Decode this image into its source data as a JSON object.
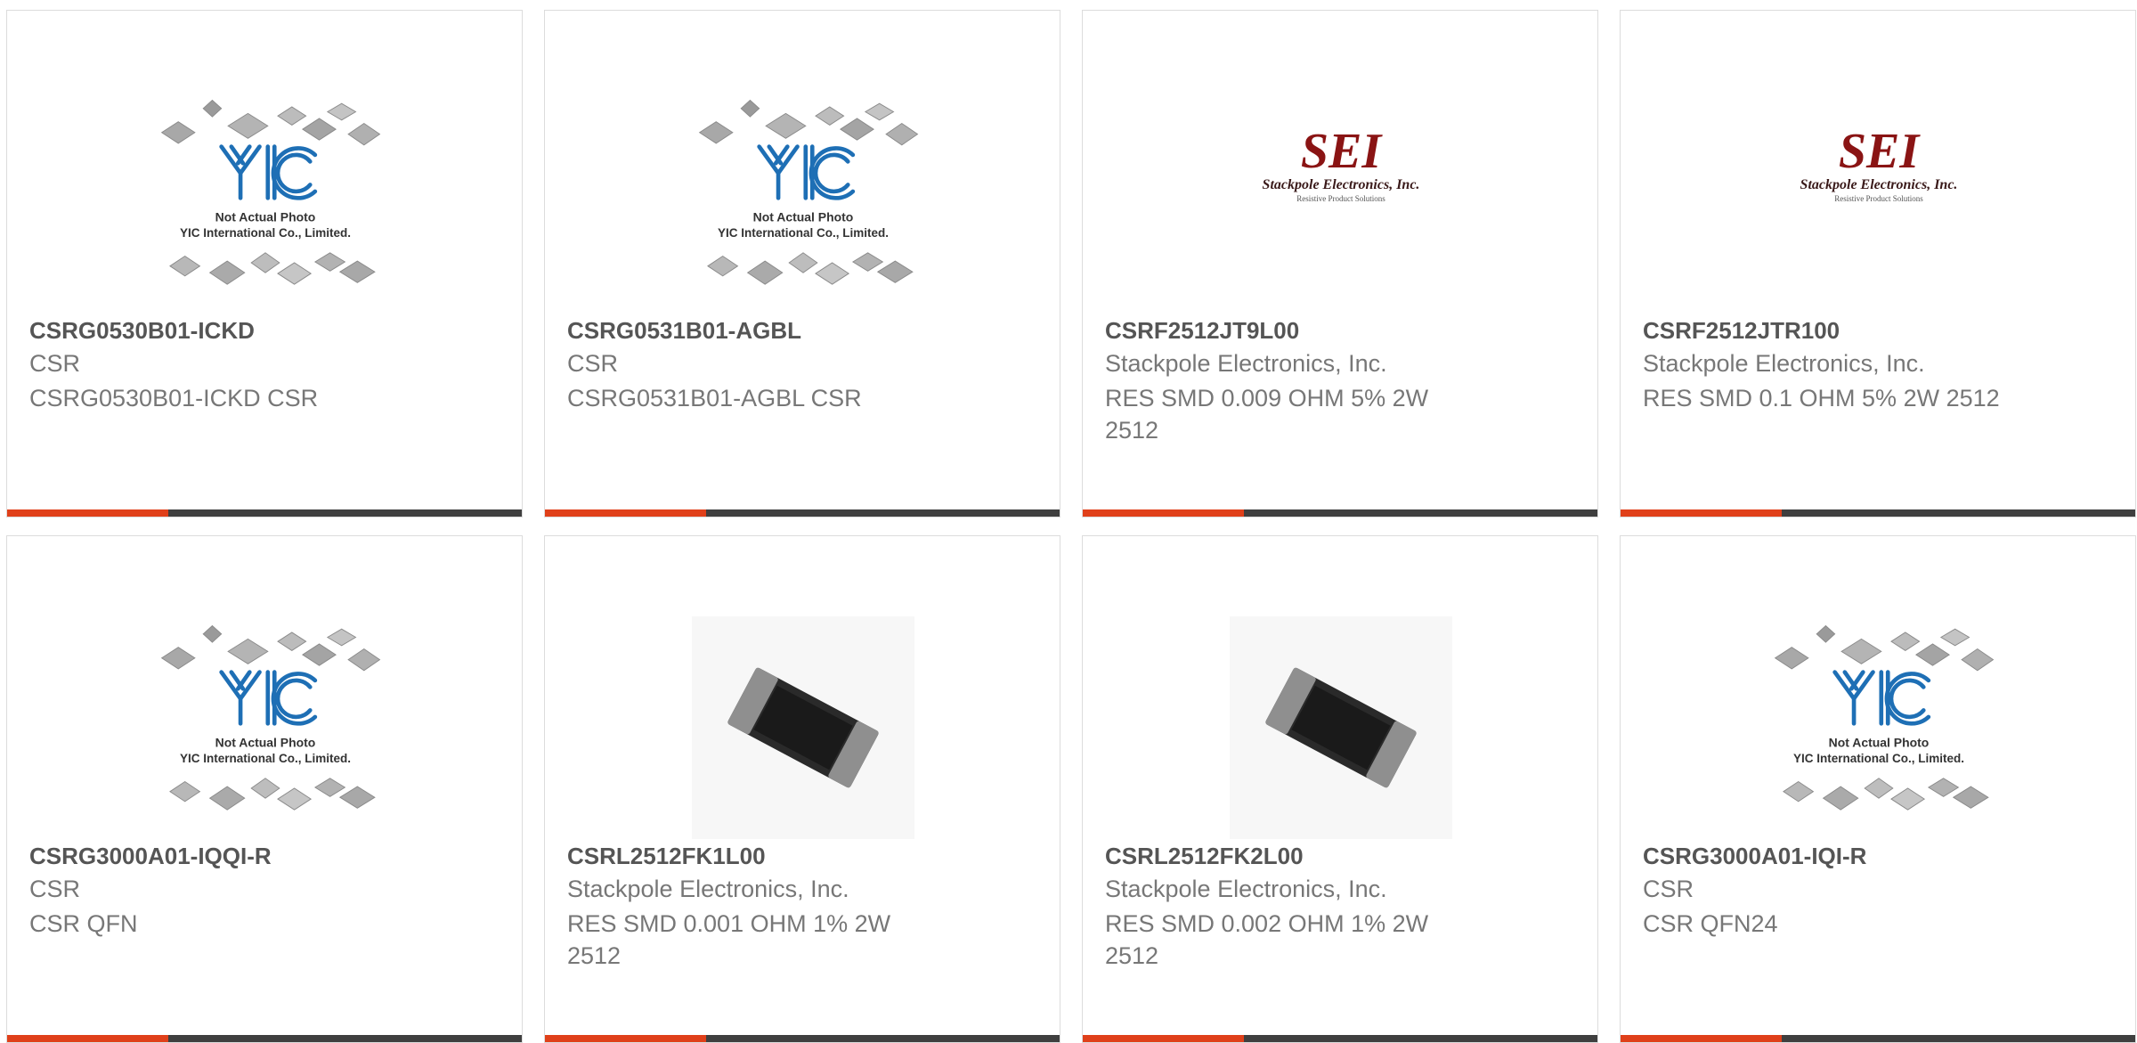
{
  "colors": {
    "accent": "#e0401a",
    "bar_dark": "#3f3f3f",
    "yic_blue": "#1e6fb5",
    "sei_red": "#8a1414"
  },
  "products": [
    {
      "part_number": "CSRG0530B01-ICKD",
      "manufacturer": "CSR",
      "description": "CSRG0530B01-ICKD CSR",
      "image": {
        "type": "yic-placeholder",
        "lines": [
          "Not Actual Photo",
          "YIC International Co., Limited."
        ],
        "logo": "YIC"
      }
    },
    {
      "part_number": "CSRG0531B01-AGBL",
      "manufacturer": "CSR",
      "description": "CSRG0531B01-AGBL CSR",
      "image": {
        "type": "yic-placeholder",
        "lines": [
          "Not Actual Photo",
          "YIC International Co., Limited."
        ],
        "logo": "YIC"
      }
    },
    {
      "part_number": "CSRF2512JT9L00",
      "manufacturer": "Stackpole Electronics, Inc.",
      "description": "RES SMD 0.009 OHM 5% 2W 2512",
      "image": {
        "type": "sei-logo",
        "lines": [
          "SEI",
          "Stackpole Electronics, Inc.",
          "Resistive Product Solutions"
        ]
      }
    },
    {
      "part_number": "CSRF2512JTR100",
      "manufacturer": "Stackpole Electronics, Inc.",
      "description": "RES SMD 0.1 OHM 5% 2W 2512",
      "image": {
        "type": "sei-logo",
        "lines": [
          "SEI",
          "Stackpole Electronics, Inc.",
          "Resistive Product Solutions"
        ]
      }
    },
    {
      "part_number": "CSRG3000A01-IQQI-R",
      "manufacturer": "CSR",
      "description": "CSR QFN",
      "image": {
        "type": "yic-placeholder",
        "lines": [
          "Not Actual Photo",
          "YIC International Co., Limited."
        ],
        "logo": "YIC"
      }
    },
    {
      "part_number": "CSRL2512FK1L00",
      "manufacturer": "Stackpole Electronics, Inc.",
      "description": "RES SMD 0.001 OHM 1% 2W 2512",
      "image": {
        "type": "resistor-photo"
      }
    },
    {
      "part_number": "CSRL2512FK2L00",
      "manufacturer": "Stackpole Electronics, Inc.",
      "description": "RES SMD 0.002 OHM 1% 2W 2512",
      "image": {
        "type": "resistor-photo"
      }
    },
    {
      "part_number": "CSRG3000A01-IQI-R",
      "manufacturer": "CSR",
      "description": "CSR QFN24",
      "image": {
        "type": "yic-placeholder",
        "lines": [
          "Not Actual Photo",
          "YIC International Co., Limited."
        ],
        "logo": "YIC"
      }
    }
  ]
}
